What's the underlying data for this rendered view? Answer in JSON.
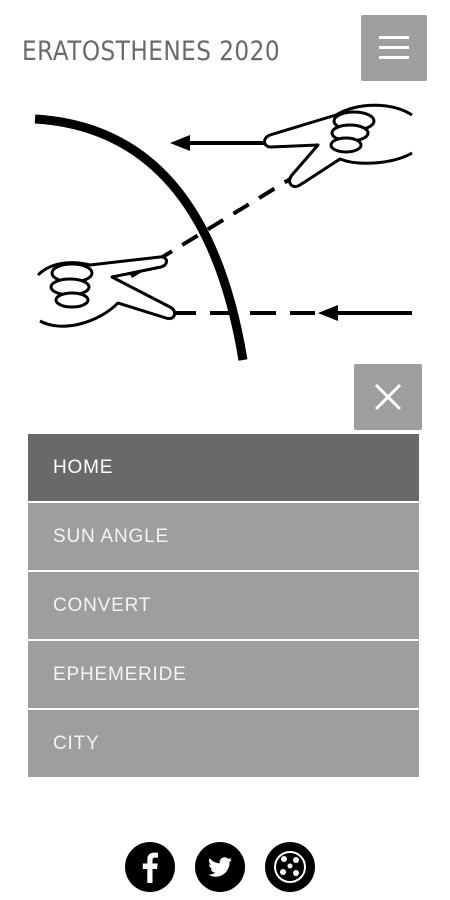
{
  "header": {
    "title": "ERATOSTHENES 2020",
    "menu_icon": "hamburger-menu-icon"
  },
  "hero": {
    "illustration": "eratosthenes-earth-sunrays-hands"
  },
  "menu": {
    "close_icon": "close-icon",
    "items": [
      {
        "label": "HOME",
        "active": true
      },
      {
        "label": "SUN ANGLE",
        "active": false
      },
      {
        "label": "CONVERT",
        "active": false
      },
      {
        "label": "EPHEMERIDE",
        "active": false
      },
      {
        "label": "CITY",
        "active": false
      }
    ]
  },
  "footer": {
    "social": [
      {
        "icon": "facebook-icon"
      },
      {
        "icon": "twitter-icon"
      },
      {
        "icon": "community-icon"
      }
    ]
  },
  "colors": {
    "button_gray": "#9e9e9e",
    "menu_active": "#6b6869",
    "title_gray": "#6a6a6a"
  }
}
